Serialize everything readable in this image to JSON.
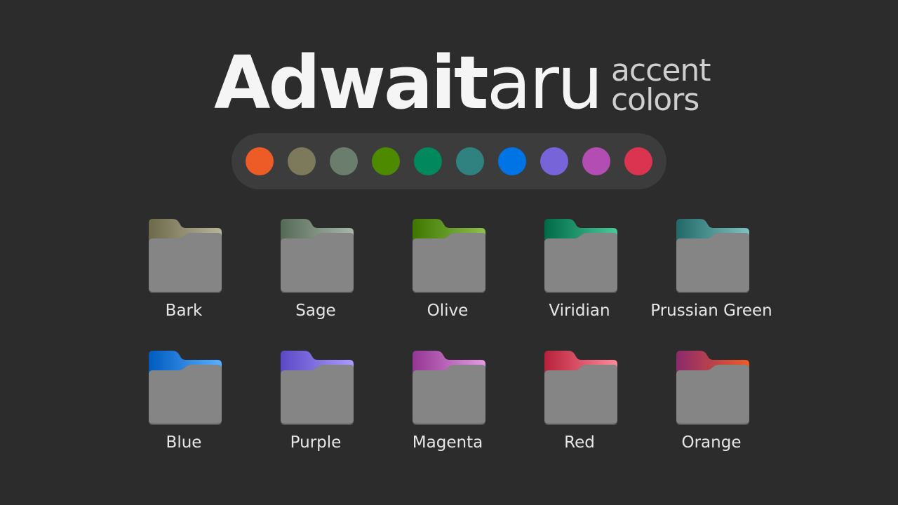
{
  "title": {
    "bold": "Adwait",
    "light": "aru",
    "subtitle_line1": "accent",
    "subtitle_line2": "colors"
  },
  "palette": [
    {
      "name": "orange-swatch",
      "color": "#ed5b26"
    },
    {
      "name": "bark-swatch",
      "color": "#7d7a5c"
    },
    {
      "name": "sage-swatch",
      "color": "#6b7d6c"
    },
    {
      "name": "olive-swatch",
      "color": "#4e8a00"
    },
    {
      "name": "viridian-swatch",
      "color": "#01885d"
    },
    {
      "name": "prussian-green-swatch",
      "color": "#308280"
    },
    {
      "name": "blue-swatch",
      "color": "#0073e5"
    },
    {
      "name": "purple-swatch",
      "color": "#7764d8"
    },
    {
      "name": "magenta-swatch",
      "color": "#b34cb3"
    },
    {
      "name": "red-swatch",
      "color": "#da3450"
    }
  ],
  "folders": [
    {
      "label": "Bark",
      "from": "#6d6a4b",
      "to": "#b7b49a"
    },
    {
      "label": "Sage",
      "from": "#566a58",
      "to": "#a9b6aa"
    },
    {
      "label": "Olive",
      "from": "#3f7600",
      "to": "#8cc04f"
    },
    {
      "label": "Viridian",
      "from": "#006a47",
      "to": "#4bc89a"
    },
    {
      "label": "Prussian Green",
      "from": "#226866",
      "to": "#7cc3c1"
    },
    {
      "label": "Blue",
      "from": "#005bbf",
      "to": "#5ab0ff"
    },
    {
      "label": "Purple",
      "from": "#5b49c4",
      "to": "#a99bff"
    },
    {
      "label": "Magenta",
      "from": "#943694",
      "to": "#e39be3"
    },
    {
      "label": "Red",
      "from": "#b7213b",
      "to": "#ff8a9c"
    },
    {
      "label": "Orange",
      "from": "#8b2a6c",
      "to": "#ed5b26"
    }
  ]
}
